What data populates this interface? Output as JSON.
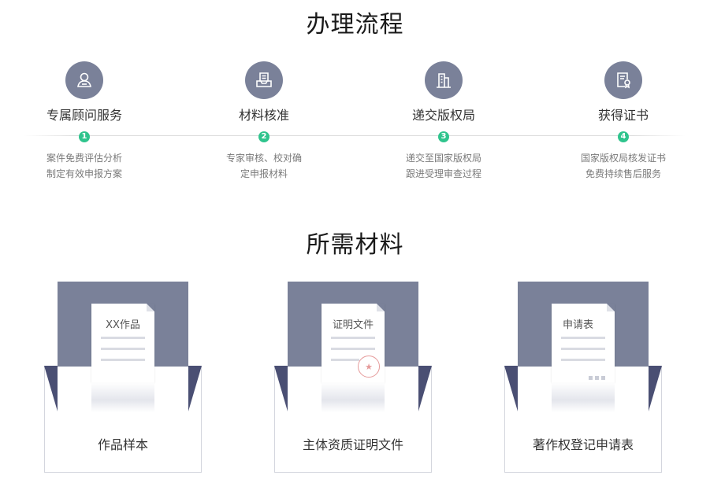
{
  "process": {
    "title": "办理流程",
    "steps": [
      {
        "icon": "user-icon",
        "title": "专属顾问服务",
        "num": "1",
        "desc": [
          "案件免费评估分析",
          "制定有效申报方案"
        ]
      },
      {
        "icon": "document-inbox-icon",
        "title": "材料核准",
        "num": "2",
        "desc": [
          "专家审核、校对确",
          "定申报材料"
        ]
      },
      {
        "icon": "building-icon",
        "title": "递交版权局",
        "num": "3",
        "desc": [
          "递交至国家版权局",
          "跟进受理审查过程"
        ]
      },
      {
        "icon": "certificate-icon",
        "title": "获得证书",
        "num": "4",
        "desc": [
          "国家版权局核发证书",
          "免费持续售后服务"
        ]
      }
    ]
  },
  "materials": {
    "title": "所需材料",
    "cards": [
      {
        "doc_label": "XX作品",
        "label": "作品样本"
      },
      {
        "doc_label": "证明文件",
        "label": "主体资质证明文件"
      },
      {
        "doc_label": "申请表",
        "label": "著作权登记申请表"
      }
    ]
  },
  "colors": {
    "accent": "#2fc48d",
    "icon_bg": "#7a8199",
    "envelope_dark": "#4a4f73"
  }
}
